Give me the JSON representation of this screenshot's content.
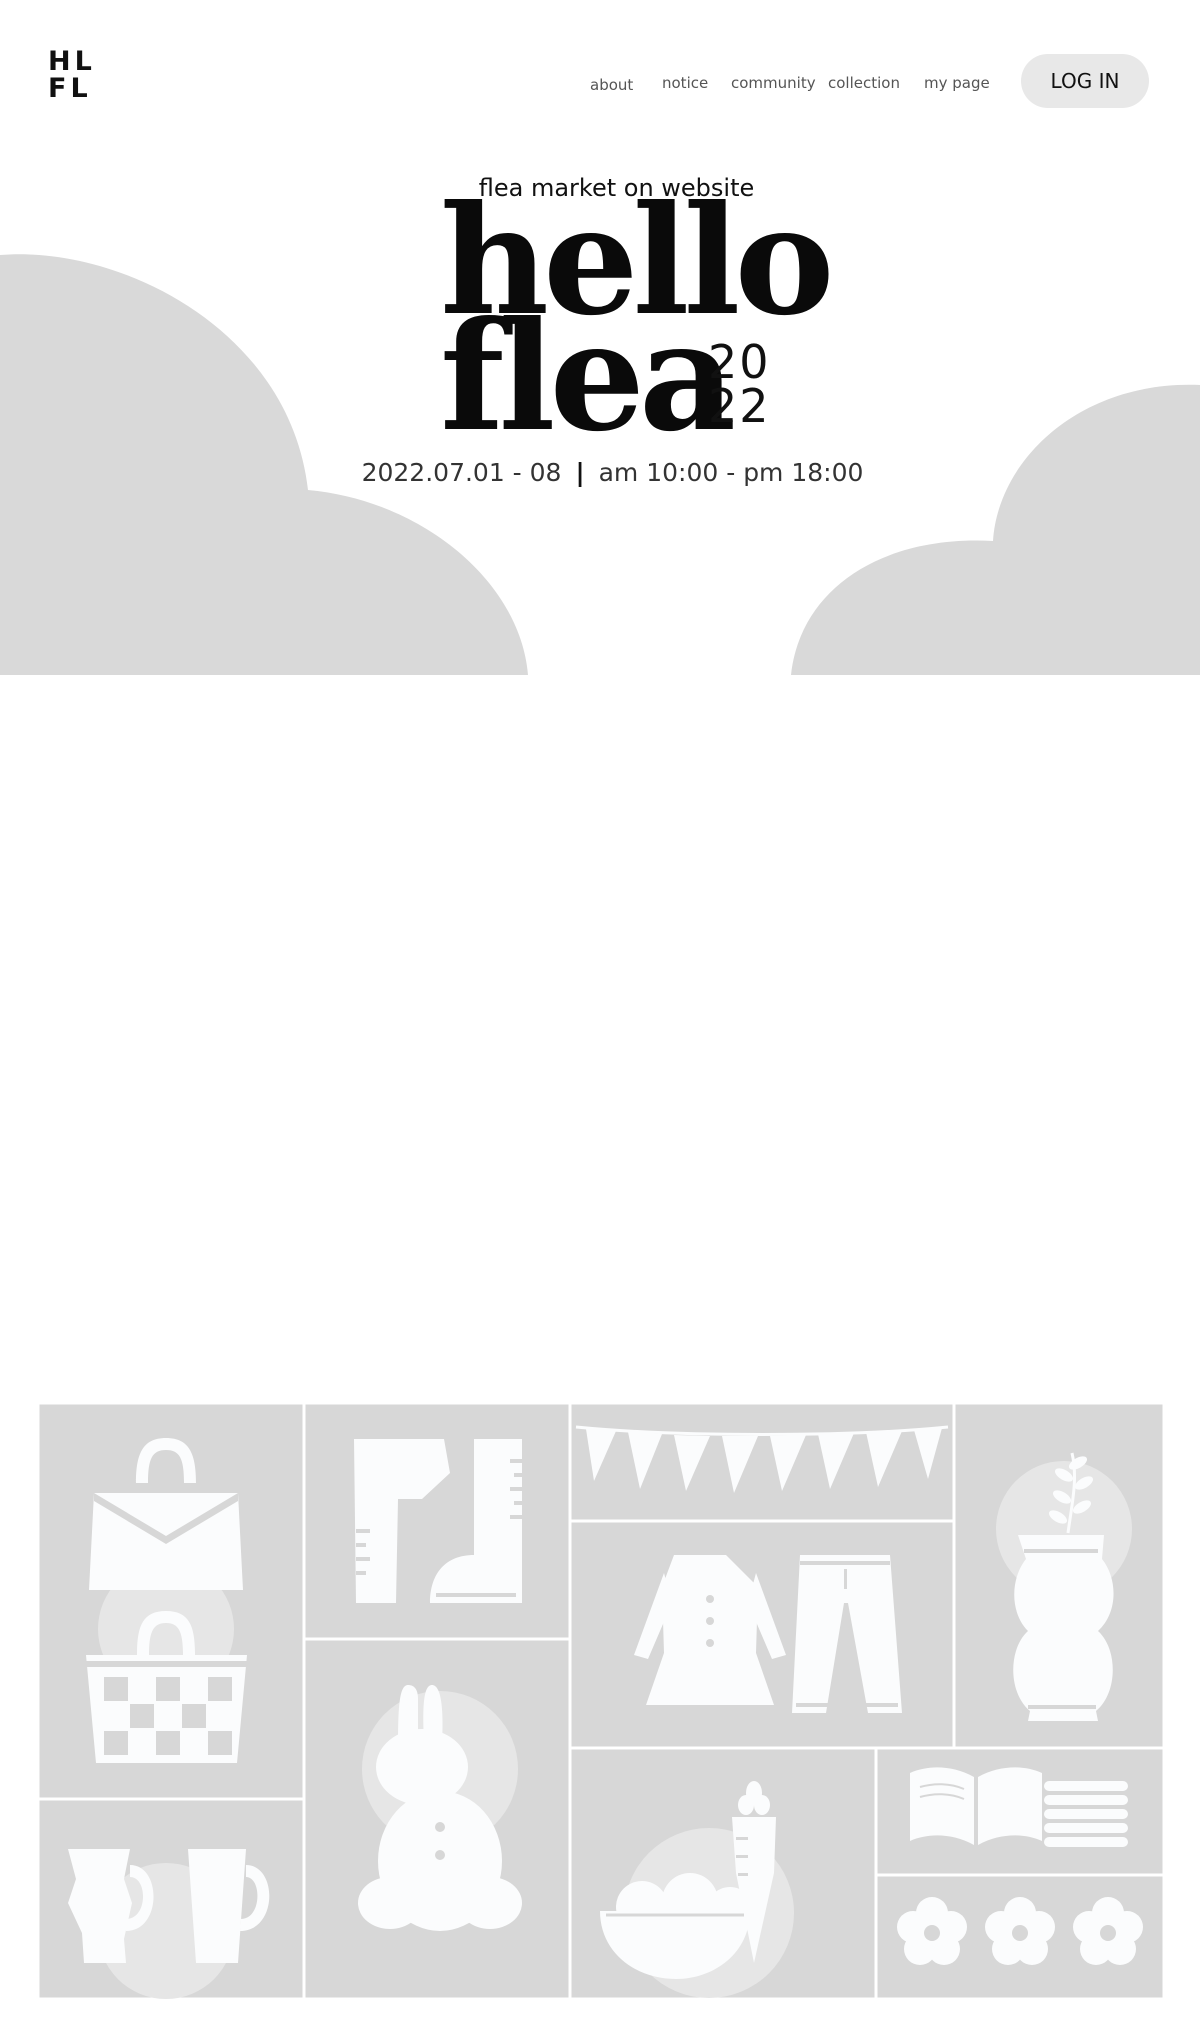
{
  "logo": {
    "line1": "HL",
    "line2": "FL"
  },
  "nav": {
    "items": [
      "about",
      "notice",
      "community",
      "collection",
      "my page"
    ],
    "login_label": "LOG IN"
  },
  "hero": {
    "tagline": "flea market on website",
    "title_line1": "hello",
    "title_line2": "flea",
    "year_top": "20",
    "year_bottom": "22",
    "dates": "2022.07.01 - 08",
    "separator": "|",
    "hours": "am 10:00 - pm 18:00"
  },
  "colors": {
    "background": "#ffffff",
    "cloud": "#d9d9d9",
    "tile": "#d7d7d7",
    "tile_circle": "#e6e6e6",
    "icon": "#fbfcfd",
    "text": "#111111",
    "button_bg": "#e8e8e8"
  },
  "illustration": {
    "icons": [
      "handbag-icon",
      "basket-icon",
      "boots-icon",
      "bunting-icon",
      "dress-icon",
      "pants-icon",
      "vase-icon",
      "bunny-icon",
      "mugs-icon",
      "bread-bowl-icon",
      "carrot-icon",
      "book-icon",
      "books-stack-icon",
      "flower-icon"
    ]
  }
}
